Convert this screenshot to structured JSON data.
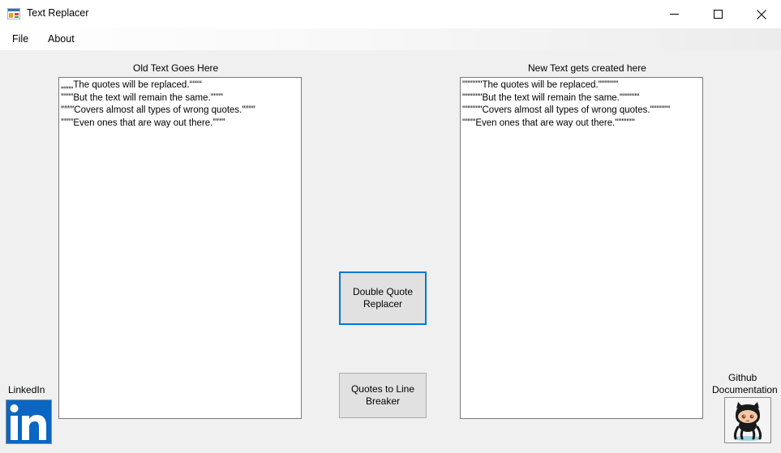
{
  "window": {
    "title": "Text Replacer",
    "icon": "windows-forms-app-icon",
    "controls": [
      "minimize-icon",
      "maximize-icon",
      "close-icon"
    ]
  },
  "menu": {
    "items": [
      {
        "label": "File"
      },
      {
        "label": "About"
      }
    ]
  },
  "left_panel": {
    "label": "Old Text Goes Here",
    "lines": [
      "„„„„The quotes will be replaced.““““",
      "””””But the text will remain the same.””””",
      "″″″″Covers almost all types of wrong quotes.″″″″",
      "ˮˮˮˮEven ones that are way out there.ˮˮˮˮ"
    ]
  },
  "right_panel": {
    "label": "New Text gets created here",
    "lines": [
      "\"\"\"\"\"\"The quotes will be replaced.\"\"\"\"\"\"",
      "\"\"\"\"\"\"But the text will remain the same.\"\"\"\"\"\"",
      "\"\"\"\"\"\"Covers almost all types of wrong quotes.\"\"\"\"\"\"",
      "\"\"\"\"Even ones that are way out there.\"\"\"\"\"\""
    ]
  },
  "buttons": {
    "double_quote": "Double Quote\nReplacer",
    "line_breaker": "Quotes to Line\nBreaker"
  },
  "links": {
    "linkedin_label": "LinkedIn",
    "linkedin_icon": "linkedin-logo-icon",
    "github_label_1": "Github",
    "github_label_2": "Documentation",
    "github_icon": "github-octocat-icon"
  },
  "colors": {
    "focus_border": "#0078d7",
    "linkedin_blue": "#0a66c2",
    "window_bg": "#f0f0f0"
  }
}
